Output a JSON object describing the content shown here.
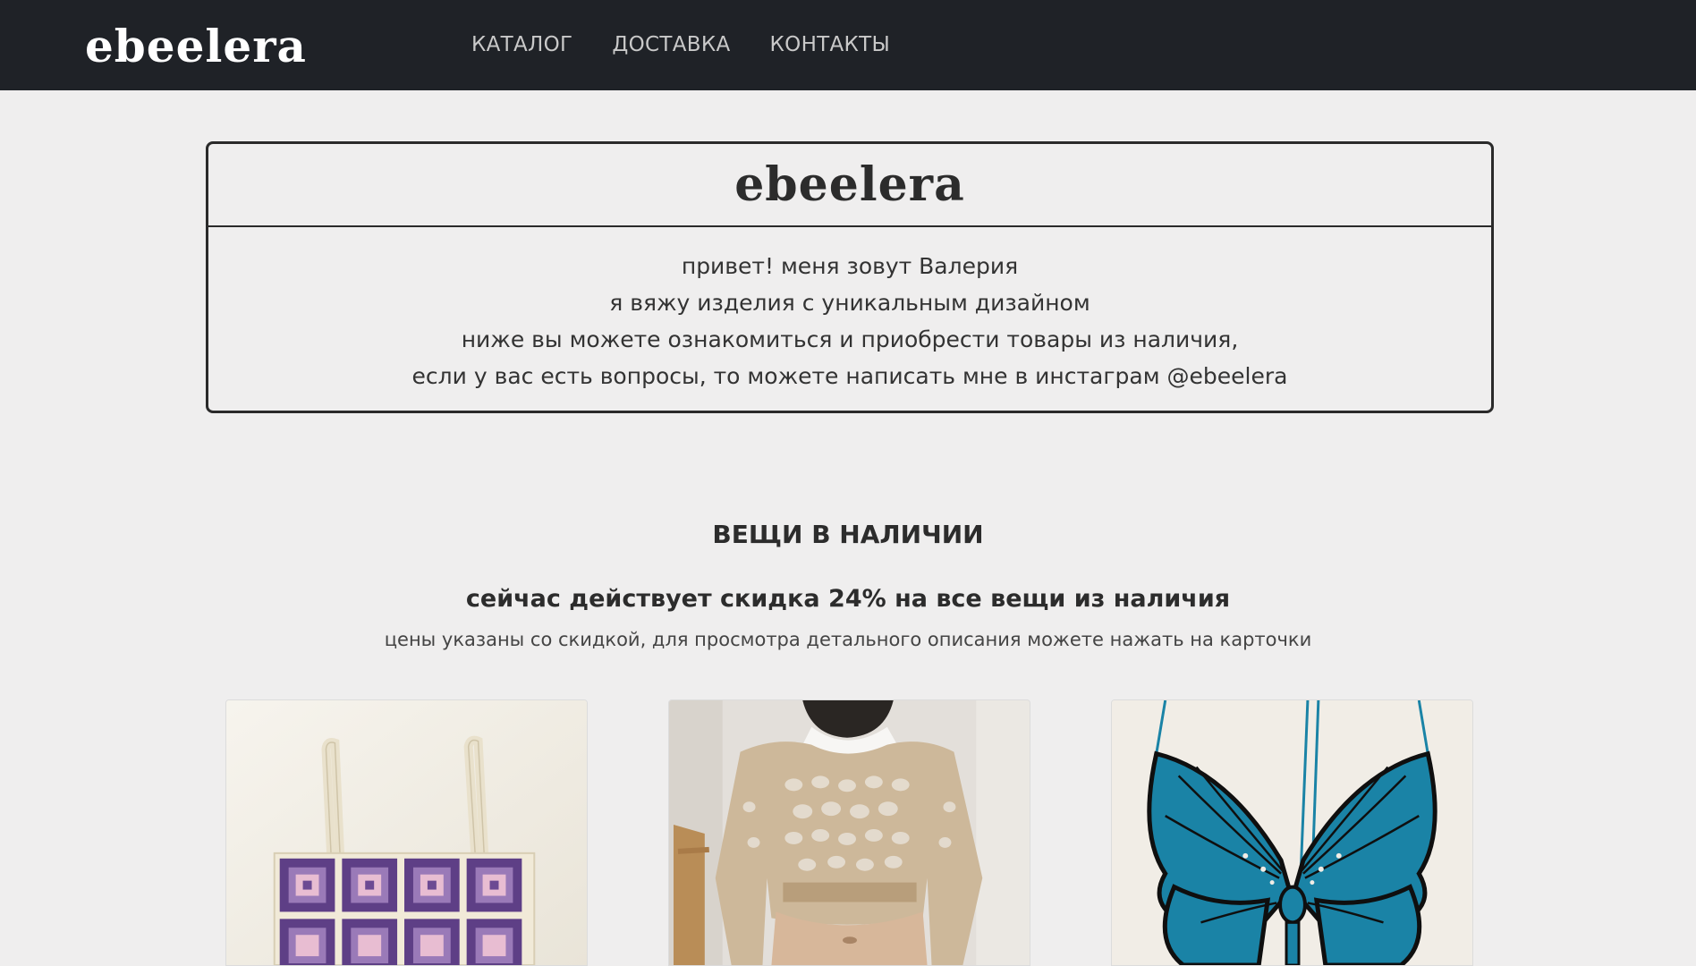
{
  "header": {
    "logo": "ebeelera",
    "nav": [
      "КАТАЛОГ",
      "ДОСТАВКА",
      "КОНТАКТЫ"
    ]
  },
  "intro": {
    "logo": "ebeelera",
    "lines": [
      "привет! меня зовут Валерия",
      "я вяжу изделия с уникальным дизайном",
      "ниже вы можете ознакомиться и приобрести товары из наличия,",
      "если у вас есть вопросы, то можете написать мне в инстаграм @ebeelera"
    ]
  },
  "catalog": {
    "title": "ВЕЩИ В НАЛИЧИИ",
    "discount": "сейчас действует скидка 24% на все вещи из наличия",
    "note": "цены указаны со скидкой, для просмотра детального описания можете нажать на карточки"
  },
  "colors": {
    "header_bg": "#1f2227",
    "page_bg": "#efeeee",
    "text": "#2c2c2c",
    "nav_text": "#c9c9c9"
  },
  "products": [
    {
      "image": "granny-square-top-photo",
      "colors": [
        "#f3efe6",
        "#6c4a93",
        "#e6b9d0",
        "#f1ead8"
      ]
    },
    {
      "image": "mesh-sweater-photo",
      "colors": [
        "#cdb89a",
        "#b89e7b",
        "#f5f3f0",
        "#d9d6d2"
      ]
    },
    {
      "image": "butterfly-top-photo",
      "colors": [
        "#f2efe8",
        "#1a83a6",
        "#0f0f0f"
      ]
    }
  ]
}
